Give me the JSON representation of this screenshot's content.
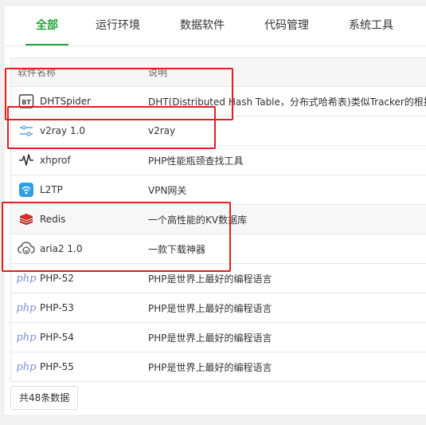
{
  "tabs": [
    {
      "label": "全部"
    },
    {
      "label": "运行环境"
    },
    {
      "label": "数据软件"
    },
    {
      "label": "代码管理"
    },
    {
      "label": "系统工具"
    }
  ],
  "table": {
    "headers": {
      "name": "软件名称",
      "desc": "说明"
    },
    "rows": [
      {
        "name": "DHTSpider",
        "desc": "DHT(Distributed Hash Table，分布式哈希表)类似Tracker的根据",
        "icon": "bt-icon"
      },
      {
        "name": "v2ray 1.0",
        "desc": "v2ray",
        "icon": "v2ray-icon"
      },
      {
        "name": "xhprof",
        "desc": "PHP性能瓶颈查找工具",
        "icon": "pulse-icon"
      },
      {
        "name": "L2TP",
        "desc": "VPN网关",
        "icon": "wifi-icon"
      },
      {
        "name": "Redis",
        "desc": "一个高性能的KV数据库",
        "icon": "redis-icon"
      },
      {
        "name": "aria2 1.0",
        "desc": "一款下载神器",
        "icon": "cloud-download-icon"
      },
      {
        "name": "PHP-52",
        "desc": "PHP是世界上最好的编程语言",
        "icon": "php-icon"
      },
      {
        "name": "PHP-53",
        "desc": "PHP是世界上最好的编程语言",
        "icon": "php-icon"
      },
      {
        "name": "PHP-54",
        "desc": "PHP是世界上最好的编程语言",
        "icon": "php-icon"
      },
      {
        "name": "PHP-55",
        "desc": "PHP是世界上最好的编程语言",
        "icon": "php-icon"
      }
    ]
  },
  "php_icon_text": "php",
  "bt_icon_text": "BT",
  "footer": {
    "count_label": "共48条数据"
  },
  "colors": {
    "accent": "#20a53a",
    "highlight": "#e02020"
  }
}
